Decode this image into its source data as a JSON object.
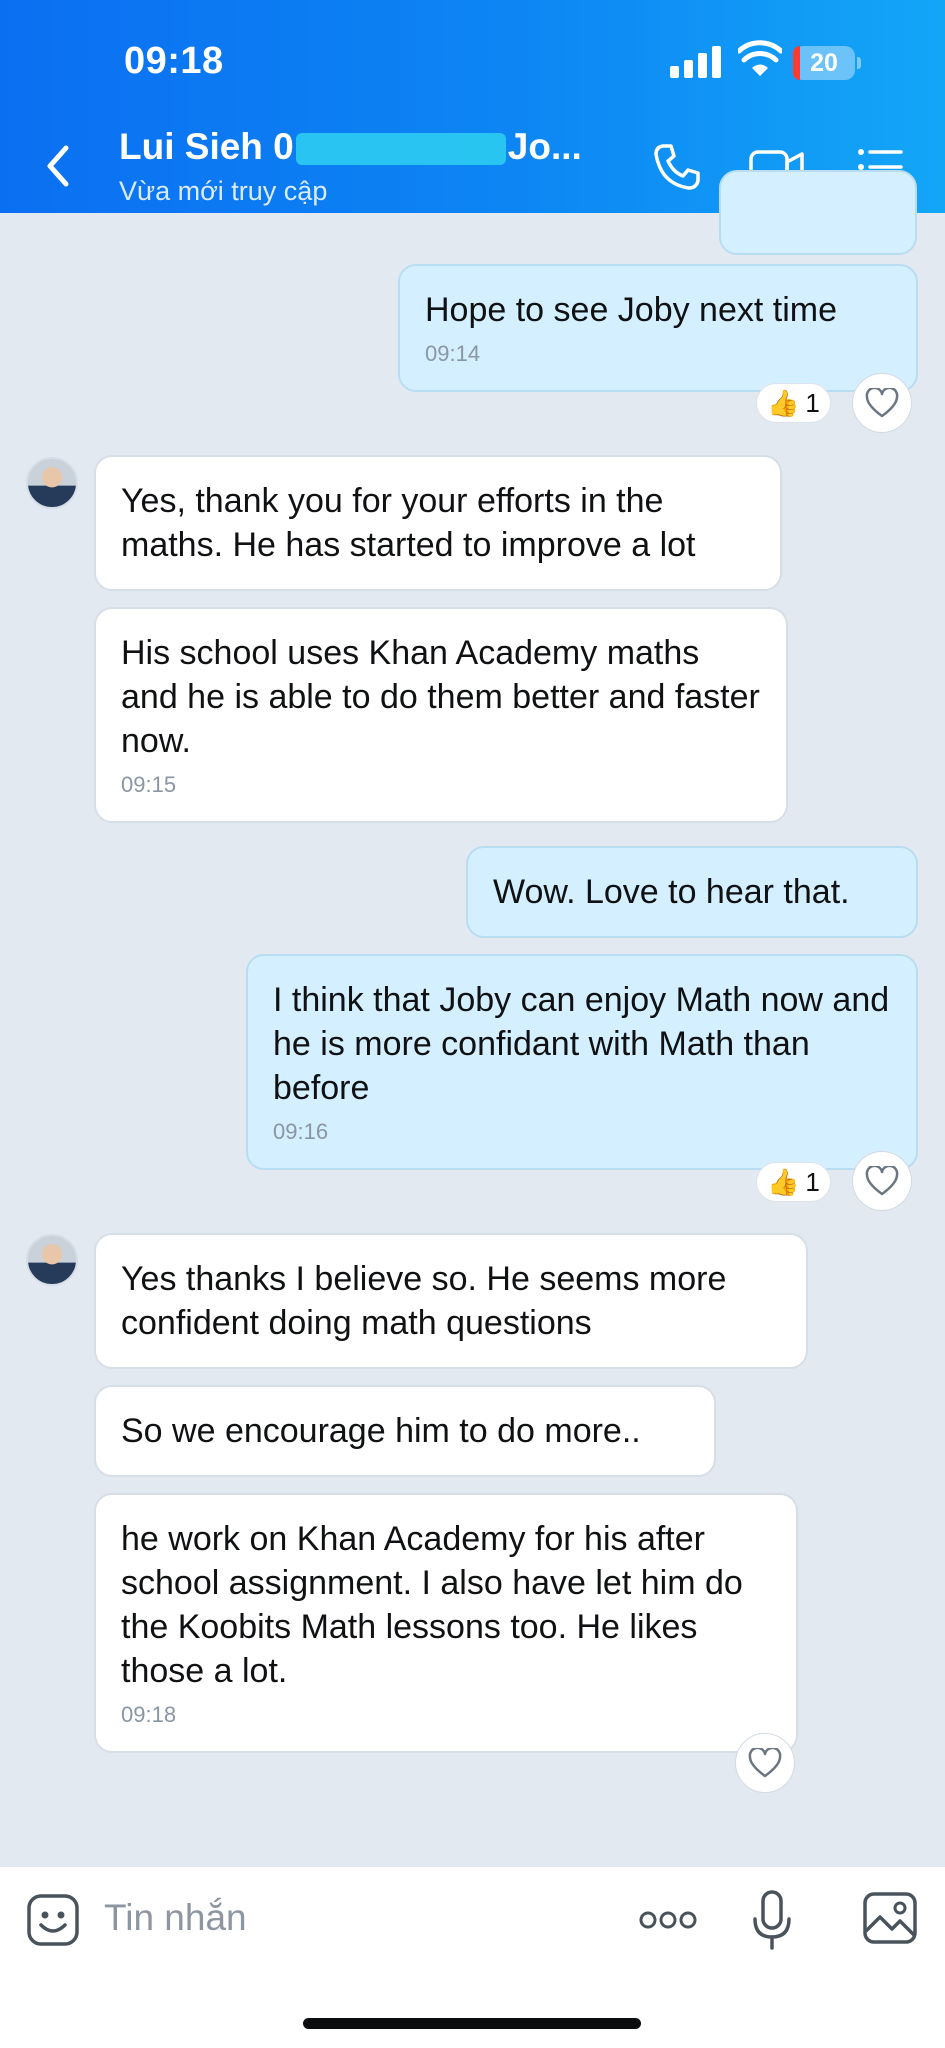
{
  "status_bar": {
    "time": "09:18",
    "battery": "20"
  },
  "header": {
    "name_prefix": "Lui Sieh 0",
    "name_suffix": "Jo...",
    "status": "Vừa mới truy cập"
  },
  "messages": [
    {
      "text": "Hope to see Joby next time",
      "time": "09:14",
      "reaction_count": "1"
    },
    {
      "text": "Yes, thank you for your efforts in the maths. He has started to improve a lot"
    },
    {
      "text": "His school uses Khan Academy maths and he is able to do them better and faster now.",
      "time": "09:15"
    },
    {
      "text": "Wow. Love to hear that."
    },
    {
      "text": "I think that Joby can enjoy Math now and he is more confidant with Math than before",
      "time": "09:16",
      "reaction_count": "1"
    },
    {
      "text": "Yes thanks I believe so. He seems more confident doing math questions"
    },
    {
      "text": "So we encourage him to do more.."
    },
    {
      "text": "he work on Khan Academy for his after school assignment. I also have let him do the Koobits Math lessons too. He likes those a lot.",
      "time": "09:18"
    }
  ],
  "composer": {
    "placeholder": "Tin nhắn"
  },
  "icons": [
    "back-icon",
    "phone-icon",
    "video-icon",
    "menu-icon",
    "sticker-icon",
    "more-icon",
    "mic-icon",
    "image-icon",
    "heart-icon",
    "thumbs-up-icon"
  ],
  "colors": {
    "header": "#0d86f4",
    "outgoing_bubble": "#d4efff",
    "incoming_bubble": "#ffffff",
    "background": "#e2e9f1"
  }
}
